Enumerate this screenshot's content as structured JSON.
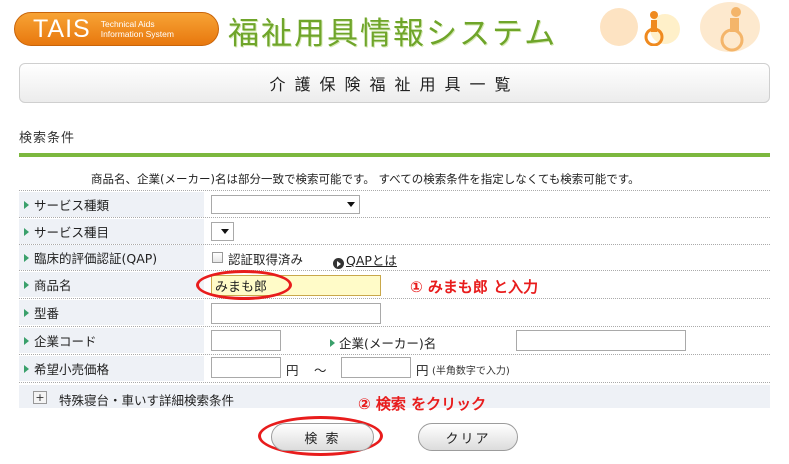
{
  "header": {
    "logo_main": "TAIS",
    "logo_sub_1": "Technical Aids",
    "logo_sub_2": "Information System",
    "site_title": "福祉用具情報システム"
  },
  "page_title": "介護保険福祉用具一覧",
  "section_title": "検索条件",
  "note": "商品名、企業(メーカー)名は部分一致で検索可能です。 すべての検索条件を指定しなくても検索可能です。",
  "form": {
    "service_type_label": "サービス種類",
    "service_item_label": "サービス種目",
    "qap_label": "臨床的評価認証(QAP)",
    "qap_checkbox_label": "認証取得済み",
    "qap_link": "QAPとは",
    "product_name_label": "商品名",
    "product_name_value": "みまも郎",
    "model_label": "型番",
    "company_code_label": "企業コード",
    "company_name_label": "企業(メーカー)名",
    "price_label": "希望小売価格",
    "price_unit_1": "円",
    "price_tilde": "〜",
    "price_unit_2": "円",
    "price_note": "(半角数字で入力)",
    "detail_toggle": "+",
    "detail_label": "特殊寝台・車いす詳細検索条件"
  },
  "annotations": {
    "step1": "① みまも郎 と入力",
    "step2": "② 検索 をクリック"
  },
  "buttons": {
    "search": "検 索",
    "clear": "クリア"
  },
  "colors": {
    "accent_green": "#7cb83e",
    "logo_orange": "#f08a1c",
    "annotation_red": "#e81c1c"
  }
}
